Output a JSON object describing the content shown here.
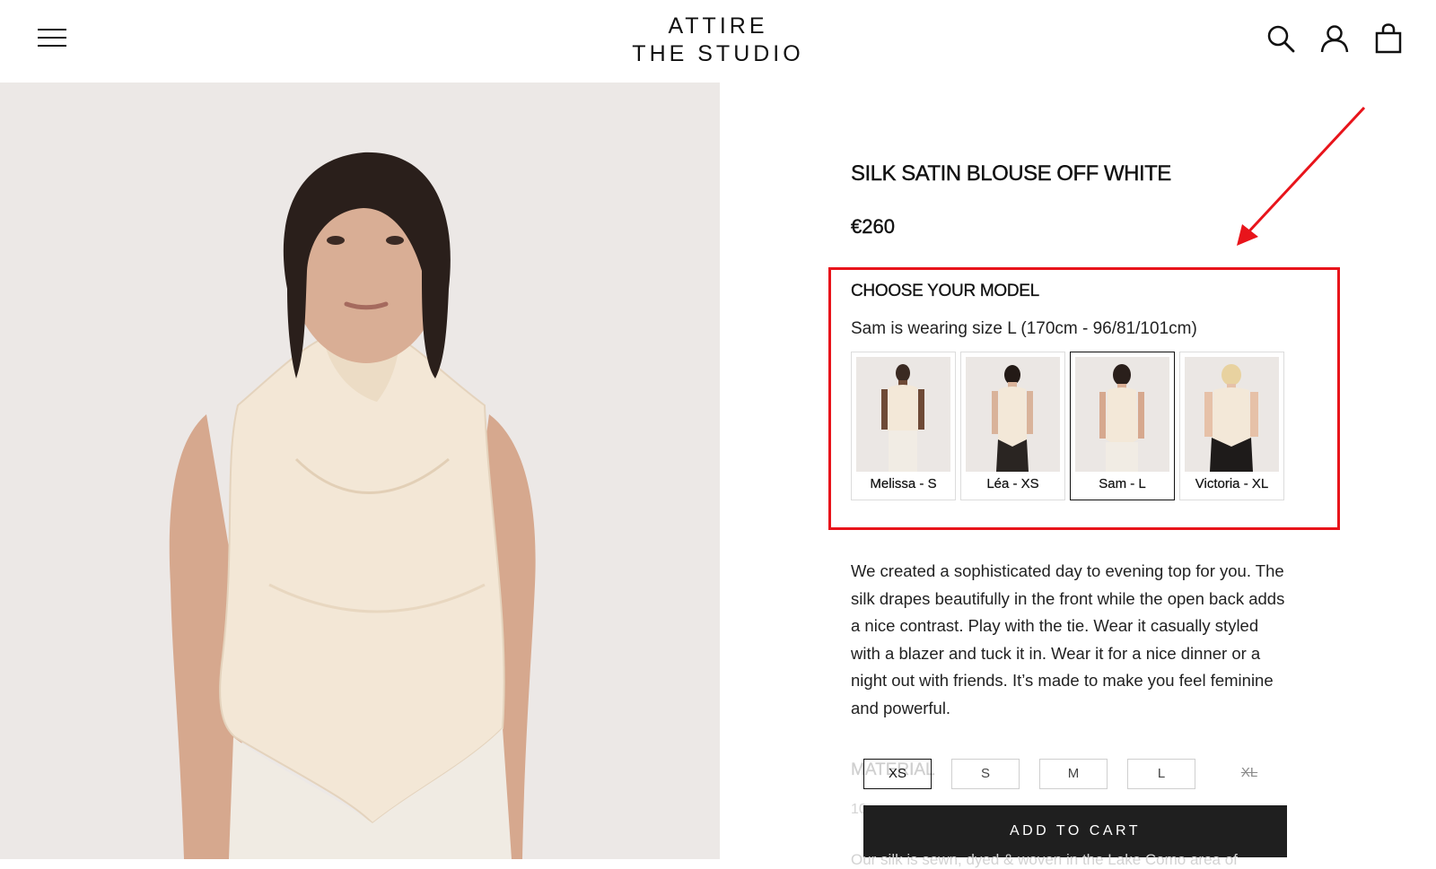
{
  "header": {
    "logo_line1": "ATTIRE",
    "logo_line2": "THE STUDIO",
    "icons": [
      "menu-icon",
      "search-icon",
      "account-icon",
      "cart-icon"
    ]
  },
  "product": {
    "title": "SILK SATIN BLOUSE OFF WHITE",
    "price": "€260",
    "description": "We created a sophisticated day to evening top for you. The silk drapes beautifully in the front while the open back adds a nice contrast. Play with the tie. Wear it casually styled with a blazer and tuck it in. Wear it for a nice dinner or a night out with friends. It’s made to make you feel feminine and powerful."
  },
  "model_selector": {
    "label": "CHOOSE YOUR MODEL",
    "wearing_text": "Sam is wearing size L (170cm - 96/81/101cm)",
    "selected": "Sam - L",
    "models": [
      {
        "name": "Melissa - S"
      },
      {
        "name": "Léa - XS"
      },
      {
        "name": "Sam - L"
      },
      {
        "name": "Victoria - XL"
      }
    ]
  },
  "material": {
    "label": "MATERIAL",
    "text": "10..."
  },
  "sizes": {
    "options": [
      {
        "label": "XS",
        "state": "selected"
      },
      {
        "label": "S",
        "state": "available"
      },
      {
        "label": "M",
        "state": "available"
      },
      {
        "label": "L",
        "state": "available"
      },
      {
        "label": "XL",
        "state": "unavailable"
      }
    ]
  },
  "cart": {
    "button_label": "ADD TO CART"
  },
  "bottom_cut_text": "Our silk is sewn, dyed & woven in the Lake Como area of",
  "colors": {
    "highlight": "#e8141b",
    "cart_button": "#1f1f1f",
    "image_background": "#ece8e6",
    "blouse": "#f3e7d6"
  }
}
